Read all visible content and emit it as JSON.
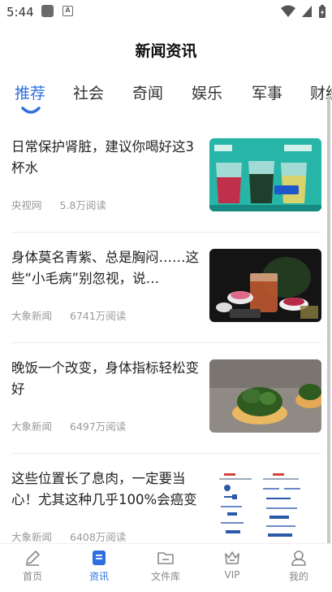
{
  "status_bar": {
    "time": "5:44",
    "icons": [
      "app-icon",
      "text-icon",
      "wifi-icon",
      "signal-icon",
      "battery-icon"
    ]
  },
  "header": {
    "title": "新闻资讯"
  },
  "tabs": [
    {
      "label": "推荐",
      "active": true
    },
    {
      "label": "社会",
      "active": false
    },
    {
      "label": "奇闻",
      "active": false
    },
    {
      "label": "娱乐",
      "active": false
    },
    {
      "label": "军事",
      "active": false
    },
    {
      "label": "财经",
      "active": false
    }
  ],
  "articles": [
    {
      "title": "日常保护肾脏，建议你喝好这3杯水",
      "source": "央视网",
      "reads": "5.8万阅读",
      "thumb": "urine-cups-image"
    },
    {
      "title": "身体莫名青紫、总是胸闷……这些“小毛病”别忽视，说…",
      "source": "大象新闻",
      "reads": "6741万阅读",
      "thumb": "flower-tea-image"
    },
    {
      "title": "晚饭一个改变，身体指标轻松变好",
      "source": "大象新闻",
      "reads": "6497万阅读",
      "thumb": "greens-dish-image"
    },
    {
      "title": "这些位置长了息肉，一定要当心！尤其这种几乎100%会癌变",
      "source": "大象新闻",
      "reads": "6408万阅读",
      "thumb": "diagram-image"
    }
  ],
  "bottom_nav": [
    {
      "label": "首页",
      "icon": "pen-icon",
      "active": false
    },
    {
      "label": "资讯",
      "icon": "document-icon",
      "active": true
    },
    {
      "label": "文件库",
      "icon": "folder-icon",
      "active": false
    },
    {
      "label": "VIP",
      "icon": "crown-icon",
      "active": false
    },
    {
      "label": "我的",
      "icon": "user-icon",
      "active": false
    }
  ],
  "colors": {
    "accent": "#2f6fdf",
    "text": "#222222",
    "meta": "#9a9a9a"
  }
}
